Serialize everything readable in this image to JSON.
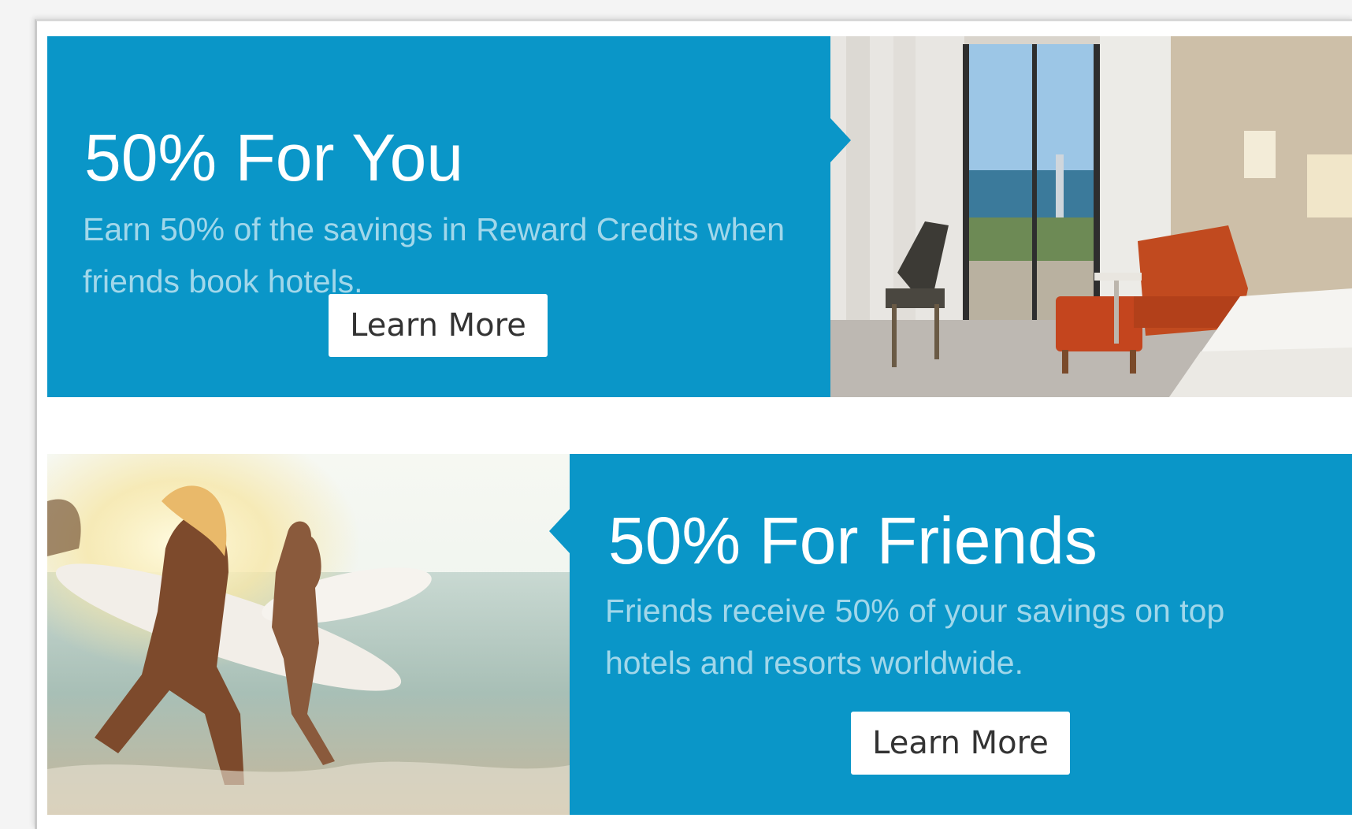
{
  "promo_you": {
    "title": "50% For You",
    "description": "Earn 50% of the savings in Reward Credits when friends book hotels.",
    "button_label": "Learn More"
  },
  "promo_friends": {
    "title": "50% For Friends",
    "description": "Friends receive 50% of your savings on top hotels and resorts worldwide.",
    "button_label": "Learn More"
  },
  "colors": {
    "panel": "#0a96c8",
    "button_bg": "#ffffff",
    "button_text": "#333333"
  },
  "images": {
    "top": "hotel-room-photo",
    "bottom": "surfers-beach-photo"
  }
}
